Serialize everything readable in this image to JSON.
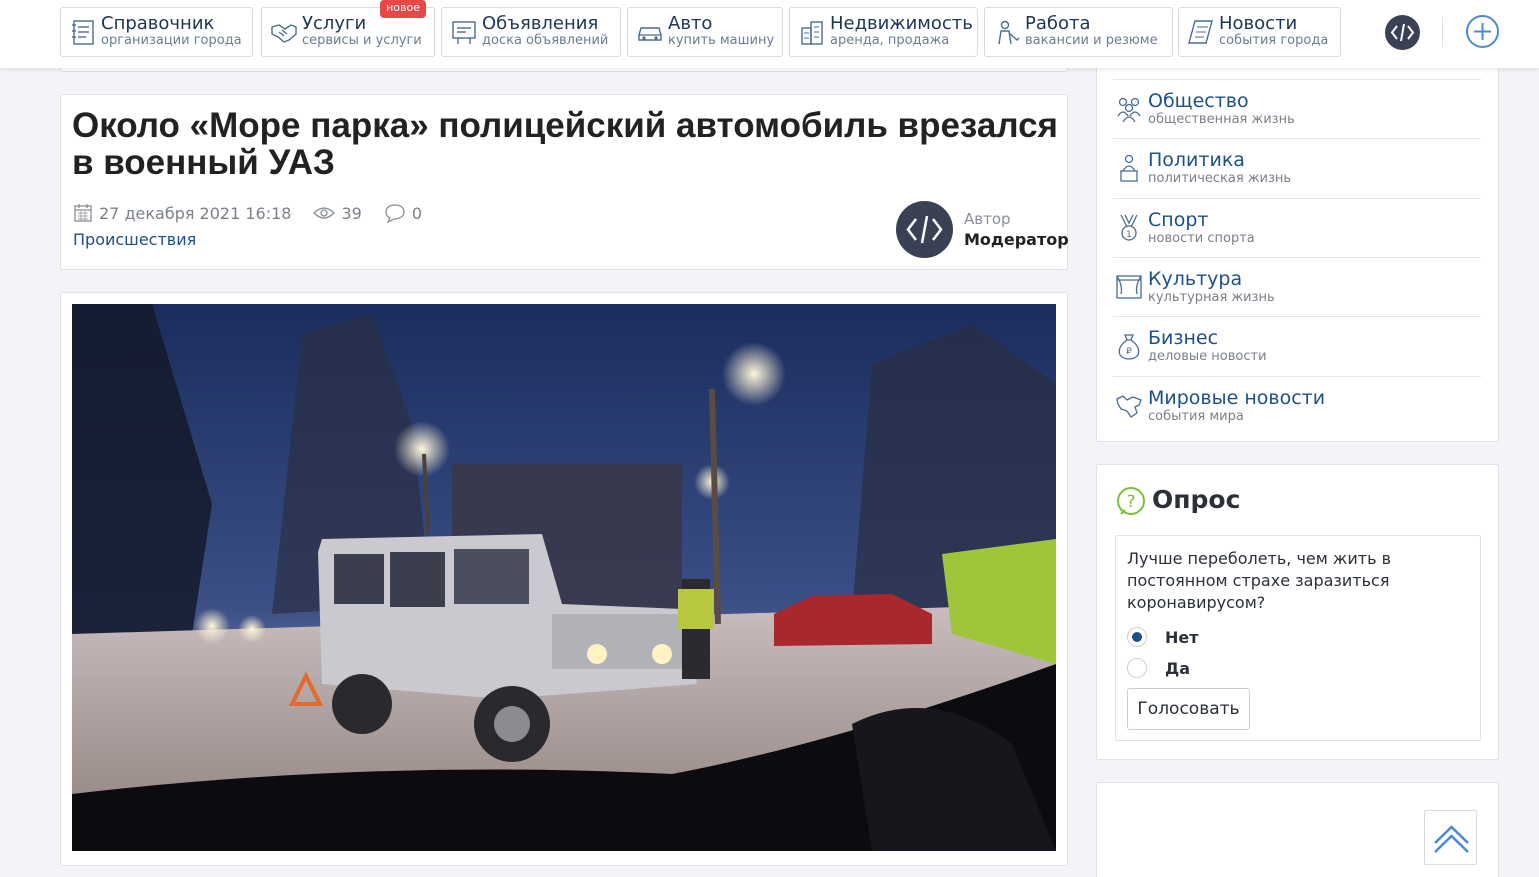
{
  "nav": [
    {
      "title": "Справочник",
      "sub": "организации города",
      "icon": "directory-icon"
    },
    {
      "title": "Услуги",
      "sub": "сервисы и услуги",
      "icon": "handshake-icon",
      "badge": "новое"
    },
    {
      "title": "Объявления",
      "sub": "доска объявлений",
      "icon": "board-icon"
    },
    {
      "title": "Авто",
      "sub": "купить машину",
      "icon": "car-icon"
    },
    {
      "title": "Недвижимость",
      "sub": "аренда, продажа",
      "icon": "buildings-icon"
    },
    {
      "title": "Работа",
      "sub": "вакансии и резюме",
      "icon": "worker-icon"
    },
    {
      "title": "Новости",
      "sub": "события города",
      "icon": "newspaper-icon"
    }
  ],
  "article": {
    "title": "Около «Море парка» полицейский автомобиль врезался в военный УАЗ",
    "date": "27 декабря 2021 16:18",
    "views": "39",
    "comments": "0",
    "category": "Происшествия",
    "author_label": "Автор",
    "author_name": "Модератор"
  },
  "rubrics": [
    {
      "title": "Общество",
      "sub": "общественная жизнь",
      "icon": "people-icon"
    },
    {
      "title": "Политика",
      "sub": "политическая жизнь",
      "icon": "speaker-icon"
    },
    {
      "title": "Спорт",
      "sub": "новости спорта",
      "icon": "medal-icon"
    },
    {
      "title": "Культура",
      "sub": "культурная жизнь",
      "icon": "theater-icon"
    },
    {
      "title": "Бизнес",
      "sub": "деловые новости",
      "icon": "money-bag-icon"
    },
    {
      "title": "Мировые новости",
      "sub": "события мира",
      "icon": "world-map-icon"
    }
  ],
  "poll": {
    "title": "Опрос",
    "question": "Лучше переболеть, чем жить в постоянном страхе заразиться коронавирусом?",
    "options": [
      {
        "label": "Нет",
        "checked": true
      },
      {
        "label": "Да",
        "checked": false
      }
    ],
    "vote_label": "Голосовать"
  },
  "colors": {
    "brand": "#1d4f8a",
    "nav_text": "#1d3557",
    "badge": "#e64747",
    "avatar": "#3a4154",
    "accent": "#4a88d9"
  }
}
